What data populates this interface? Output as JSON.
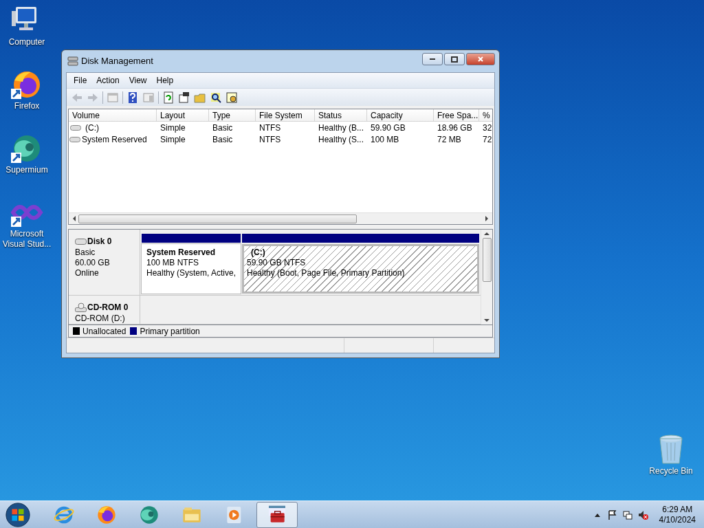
{
  "desktop_icons": [
    {
      "label": "Computer",
      "kind": "computer"
    },
    {
      "label": "Firefox",
      "kind": "firefox"
    },
    {
      "label": "Supermium",
      "kind": "supermium"
    },
    {
      "label": "Microsoft Visual Stud...",
      "kind": "vstudio"
    }
  ],
  "recycle_bin": {
    "label": "Recycle Bin"
  },
  "window": {
    "title": "Disk Management",
    "menu": [
      "File",
      "Action",
      "View",
      "Help"
    ]
  },
  "volume_list": {
    "columns": [
      "Volume",
      "Layout",
      "Type",
      "File System",
      "Status",
      "Capacity",
      "Free Spa...",
      "%"
    ],
    "rows": [
      {
        "kind": "c",
        "cells": [
          "(C:)",
          "Simple",
          "Basic",
          "NTFS",
          "Healthy (B...",
          "59.90 GB",
          "18.96 GB",
          "32"
        ]
      },
      {
        "kind": "sys",
        "cells": [
          "System Reserved",
          "Simple",
          "Basic",
          "NTFS",
          "Healthy (S...",
          "100 MB",
          "72 MB",
          "72"
        ]
      }
    ]
  },
  "disks": [
    {
      "kind": "disk",
      "name": "Disk 0",
      "lines": [
        "Basic",
        "60.00 GB",
        "Online"
      ],
      "partitions": [
        {
          "name": "System Reserved",
          "size": "100 MB NTFS",
          "status": "Healthy (System, Active,",
          "selected": false
        },
        {
          "name": "(C:)",
          "size": "59.90 GB NTFS",
          "status": "Healthy (Boot, Page File, Primary Partition)",
          "selected": true
        }
      ]
    },
    {
      "kind": "cdrom",
      "name": "CD-ROM 0",
      "lines": [
        "CD-ROM (D:)"
      ]
    }
  ],
  "legend": [
    {
      "label": "Unallocated",
      "color": "#000000"
    },
    {
      "label": "Primary partition",
      "color": "#000080"
    }
  ],
  "taskbar": {
    "apps": [
      {
        "kind": "ie",
        "active": false
      },
      {
        "kind": "firefox",
        "active": false
      },
      {
        "kind": "supermium",
        "active": false
      },
      {
        "kind": "explorer",
        "active": false
      },
      {
        "kind": "media",
        "active": false
      },
      {
        "kind": "diskmgmt",
        "active": true
      }
    ],
    "time": "6:29 AM",
    "date": "4/10/2024"
  }
}
